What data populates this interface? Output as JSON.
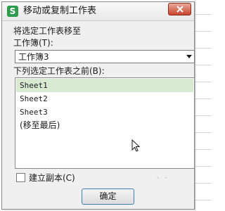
{
  "dialog": {
    "title": "移动或复制工作表",
    "app_icon_letter": "S",
    "move_label": "将选定工作表移至",
    "workbook_label": "工作簿(T):",
    "workbook_selected": "工作簿3",
    "before_label": "下列选定工作表之前(B):",
    "sheets": [
      "Sheet1",
      "Sheet2",
      "Sheet3",
      "(移至最后)"
    ],
    "selected_sheet_index": 0,
    "copy_label": "建立副本(C)",
    "copy_checked": false,
    "ok_label": "确定"
  },
  "colors": {
    "accent": "#3c7fb1",
    "selection": "#d9ead3",
    "close_button": "#c8452e",
    "app_icon": "#2f9b4e"
  }
}
